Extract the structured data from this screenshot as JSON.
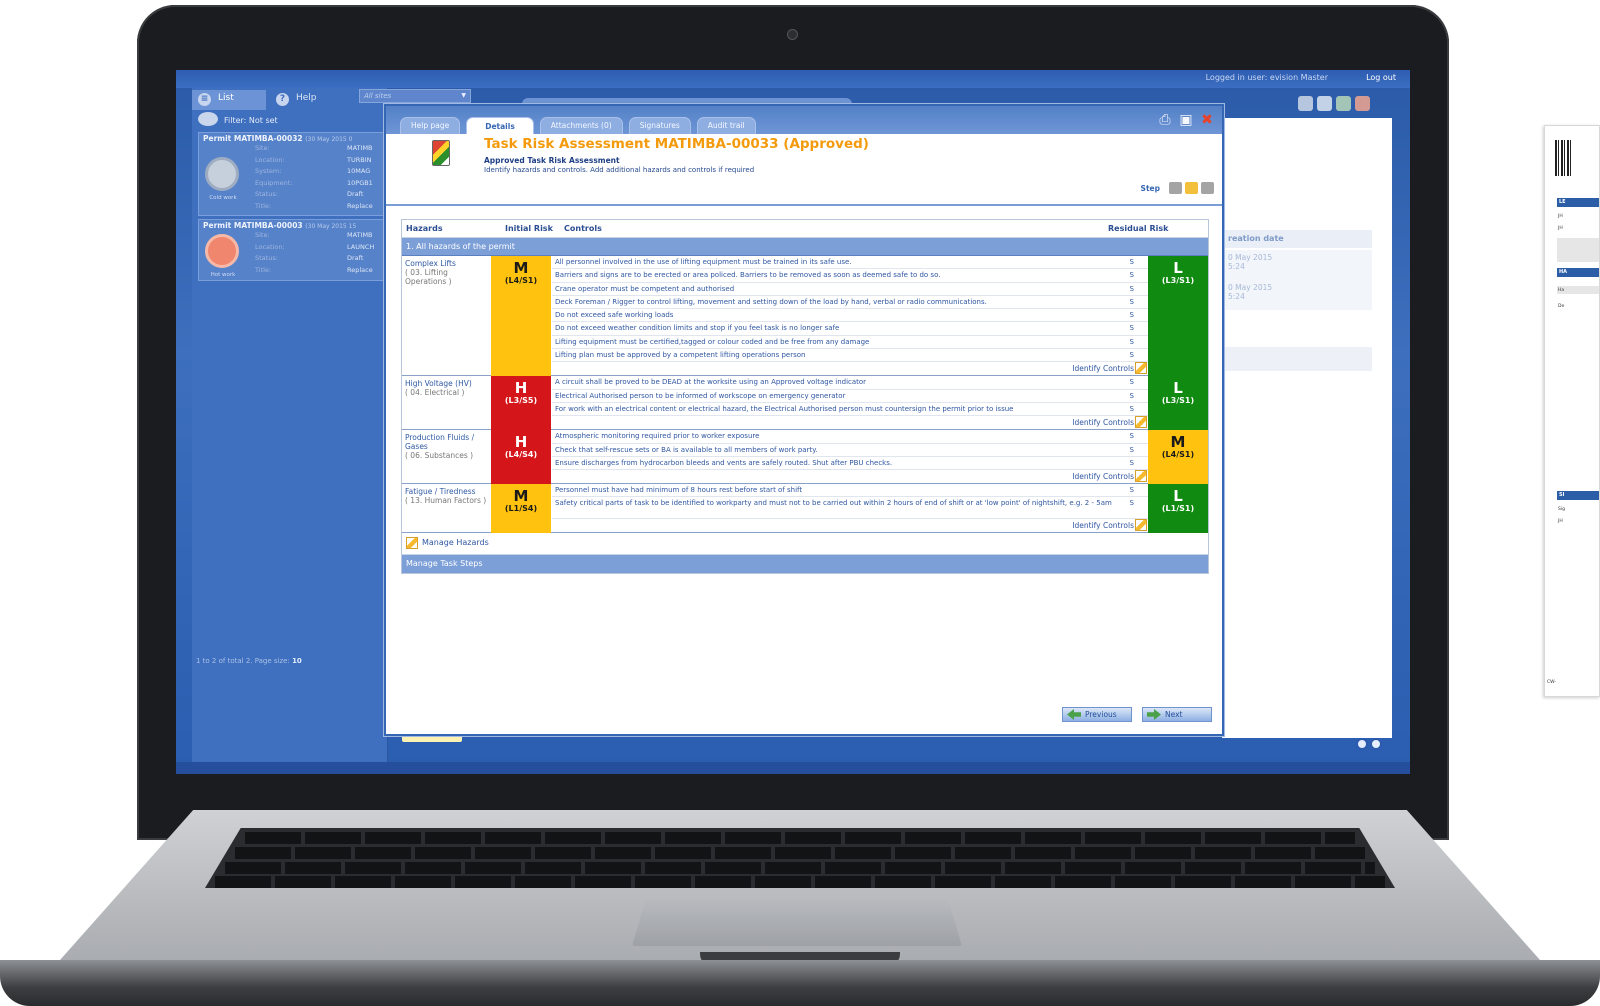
{
  "header": {
    "logged_in": "Logged in user: evision Master",
    "logout": "Log out"
  },
  "left_tabs": [
    {
      "label": "List",
      "icon": "list-icon"
    },
    {
      "label": "Help",
      "icon": "help-icon"
    }
  ],
  "site_filter": {
    "placeholder": "All sites"
  },
  "filter": {
    "label": "Filter:  Not set"
  },
  "permits": [
    {
      "title": "Permit  MATIMBA-00032",
      "date": "(30 May 2015 0",
      "type": "Cold work",
      "fields": [
        {
          "k": "Site:",
          "v": "MATIMB"
        },
        {
          "k": "Location:",
          "v": "TURBIN"
        },
        {
          "k": "System:",
          "v": "10MAG"
        },
        {
          "k": "Equipment:",
          "v": "10PGB1"
        },
        {
          "k": "Status:",
          "v": "Draft"
        },
        {
          "k": "Title:",
          "v": "Replace"
        }
      ]
    },
    {
      "title": "Permit  MATIMBA-00003",
      "date": "(30 May 2015 15",
      "type": "Hot work",
      "fields": [
        {
          "k": "Site:",
          "v": "MATIMB"
        },
        {
          "k": "Location:",
          "v": "LAUNCH"
        },
        {
          "k": "Status:",
          "v": "Draft"
        },
        {
          "k": "Title:",
          "v": "Replace"
        }
      ]
    }
  ],
  "paging": {
    "text": "1 to 2 of total 2. Page size:",
    "size": "10"
  },
  "background_list": {
    "column": "reation date",
    "rows": [
      {
        "date": "0 May 2015",
        "time": "5:24"
      },
      {
        "date": "0 May 2015",
        "time": "5:24"
      }
    ]
  },
  "dialog": {
    "tabs": [
      "Help page",
      "Details",
      "Attachments (0)",
      "Signatures",
      "Audit trail"
    ],
    "active_tab": "Details",
    "title": "Task Risk Assessment MATIMBA-00033 (Approved)",
    "subtitle": "Approved Task Risk Assessment",
    "description": "Identify hazards and controls. Add additional hazards and controls if required",
    "step_label": "Step",
    "columns": {
      "hazards": "Hazards",
      "initial": "Initial Risk",
      "controls": "Controls",
      "residual": "Residual Risk"
    },
    "group": "1. All hazards of the permit",
    "identify_label": "Identify Controls",
    "control_flag": "S",
    "hazards": [
      {
        "name": "Complex Lifts",
        "category": "( 03. Lifting Operations )",
        "initial": {
          "level": "M",
          "code": "(L4/S1)"
        },
        "residual": {
          "level": "L",
          "code": "(L3/S1)"
        },
        "controls": [
          "All personnel involved in the use of lifting equipment must be trained in its safe use.",
          "Barriers and signs are to be erected or area policed. Barriers to be removed as soon as deemed safe to do so.",
          "Crane operator must be competent and authorised",
          "Deck Foreman / Rigger to control lifting, movement and setting down of the load by hand, verbal or radio communications.",
          "Do not exceed safe working loads",
          "Do not exceed weather condition limits and stop if you feel task is no longer safe",
          "Lifting equipment must be certified,tagged or colour coded and be free from any damage",
          "Lifting plan must be approved by a competent lifting operations person"
        ]
      },
      {
        "name": "High Voltage (HV)",
        "category": "( 04. Electrical )",
        "initial": {
          "level": "H",
          "code": "(L3/S5)"
        },
        "residual": {
          "level": "L",
          "code": "(L3/S1)"
        },
        "controls": [
          "A circuit shall be proved to be DEAD at the worksite using an Approved voltage indicator",
          "Electrical Authorised person to be informed of workscope on emergency generator",
          "For work with an electrical content or electrical hazard, the Electrical Authorised person must countersign the permit prior to issue"
        ]
      },
      {
        "name": "Production Fluids / Gases",
        "category": "( 06. Substances )",
        "initial": {
          "level": "H",
          "code": "(L4/S4)"
        },
        "residual": {
          "level": "M",
          "code": "(L4/S1)"
        },
        "controls": [
          "Atmospheric monitoring required prior to worker exposure",
          "Check that self-rescue sets or BA is available to all members of work party.",
          "Ensure discharges from hydrocarbon bleeds and vents are safely routed. Shut after PBU checks."
        ]
      },
      {
        "name": "Fatigue / Tiredness",
        "category": "( 13. Human Factors )",
        "initial": {
          "level": "M",
          "code": "(L1/S4)"
        },
        "residual": {
          "level": "L",
          "code": "(L1/S1)"
        },
        "controls": [
          "Personnel must have had minimum of 8 hours rest before start of shift",
          "Safety critical parts of task to be identified to workparty and must not to be carried out within 2 hours of end of shift or at 'low point' of nightshift, e.g. 2 - 5am"
        ]
      }
    ],
    "manage_hazards": "Manage Hazards",
    "manage_steps": "Manage Task Steps",
    "previous": "Previous",
    "next": "Next"
  },
  "side_doc": {
    "sections": [
      "LE",
      "HA",
      "SI"
    ],
    "lines": [
      "JH",
      "JH",
      "Ha",
      "De",
      "Sig",
      "JH"
    ],
    "footer": "CW-"
  }
}
